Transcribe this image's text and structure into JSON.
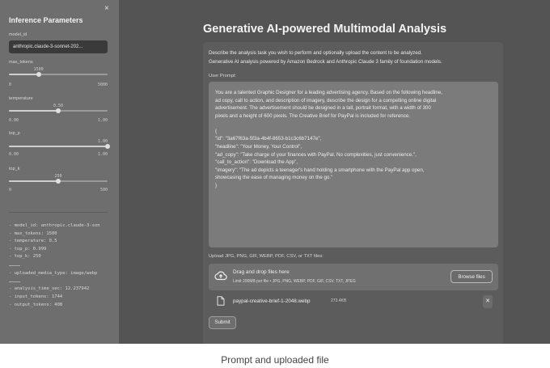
{
  "sidebar": {
    "title": "Inference Parameters",
    "close_icon": "×",
    "model_id_label": "model_id",
    "model_id_value": "anthropic.claude-3-sonnet-202...",
    "max_tokens": {
      "label": "max_tokens",
      "value": "1500",
      "min": "0",
      "max": "5000",
      "level": 0.3
    },
    "temperature": {
      "label": "temperature",
      "value": "0.50",
      "min": "0.00",
      "max": "1.00",
      "level": 0.5
    },
    "top_p": {
      "label": "top_p",
      "value": "1.00",
      "min": "0.00",
      "max": "1.00",
      "level": 1.0
    },
    "top_k": {
      "label": "top_k",
      "value": "250",
      "min": "0",
      "max": "500",
      "level": 0.5
    },
    "log_group1": [
      "- model_id: anthropic.claude-3-son",
      "- max_tokens: 1500",
      "- temperature: 0.5",
      "- top_p: 0.999",
      "- top_k: 250"
    ],
    "log_sep": "---",
    "log_uploaded": "- uploaded_media_type: image/webp",
    "log_group2": [
      "- analysis_time_sec: 12.237942",
      "- input_tokens: 1744",
      "- output_tokens: 408"
    ]
  },
  "main": {
    "title": "Generative AI-powered Multimodal Analysis",
    "description": [
      "Describe the analysis task you wish to perform and optionally upload the content to be analyzed.",
      "Generative AI analysis powered by Amazon Bedrock and Anthropic Claude 3 family of foundation models."
    ],
    "prompt_label": "User Prompt:",
    "prompt_lines": [
      "You are a talented Graphic Designer for a leading advertising agency. Based on the following headline,",
      "ad copy, call to action, and description of imagery, describe the design for a compelling online digital",
      "advertisement. The advertisement should be designed in a tall, portrait format, with a width of 300",
      "pixels and a height of 600 pixels. The Creative Brief for PayPal is included for reference.",
      "",
      "{",
      "    \"id\": \"3a67f63a-5f3a-4b4f-8653-b1c3c6b7147e\",",
      "    \"headline\": \"Your Money, Your Control\",",
      "    \"ad_copy\": \"Take charge of your finances with PayPal. No complexities, just convenience.\",",
      "    \"call_to_action\": \"Download the App\",",
      "    \"imagery\": \"The ad depicts a teenager's hand holding a smartphone with the PayPal app open,",
      "    showcasing the ease of managing money on the go.\"",
      "}"
    ],
    "upload_label": "Upload JPG, PNG, GIF, WEBP, PDF, CSV, or TXT files:",
    "drop_main": "Drag and drop files here",
    "drop_sub": "Limit 200MB per file • JPG, PNG, WEBP, PDF, GIF, CSV, TXT, JPEG",
    "browse_label": "Browse files",
    "file_name": "paypal-creative-brief-1-2048.webp",
    "file_size": "273.4KB",
    "file_remove": "✕",
    "submit_label": "Submit"
  },
  "caption": "Prompt and uploaded file",
  "icons": {
    "upload": "cloud-upload-icon",
    "file": "file-icon",
    "close": "close-icon"
  }
}
